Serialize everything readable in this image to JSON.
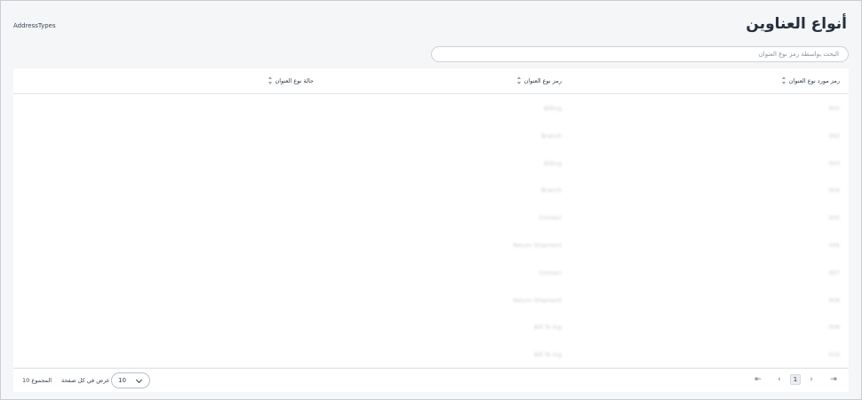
{
  "header": {
    "title": "أنواع العناوين",
    "route_label": "AddressTypes"
  },
  "search": {
    "placeholder": "البحث بواسطة رمز نوع العنوان"
  },
  "table": {
    "columns": [
      {
        "label": "رمز مورد نوع العنوان"
      },
      {
        "label": "رمز نوع العنوان"
      },
      {
        "label": "حالة نوع العنوان"
      }
    ],
    "rows": [
      {
        "code": "001",
        "name": "Billing"
      },
      {
        "code": "002",
        "name": "Branch"
      },
      {
        "code": "003",
        "name": "Billing"
      },
      {
        "code": "004",
        "name": "Branch"
      },
      {
        "code": "005",
        "name": "Contact"
      },
      {
        "code": "006",
        "name": "Return Shipment"
      },
      {
        "code": "007",
        "name": "Contact"
      },
      {
        "code": "008",
        "name": "Return Shipment"
      },
      {
        "code": "009",
        "name": "Bill To Ing"
      },
      {
        "code": "010",
        "name": "Bill To Ing"
      }
    ]
  },
  "footer": {
    "total_label": "المجموع 10",
    "per_page_label": "عرض في كل صفحة",
    "page_size": "10",
    "current_page": "1"
  },
  "icons": {
    "first_page": "first-page-icon",
    "prev_page": "chevron-left-icon",
    "next_page": "chevron-right-icon",
    "last_page": "last-page-icon",
    "sort": "sort-icon",
    "dropdown": "chevron-down-icon"
  }
}
